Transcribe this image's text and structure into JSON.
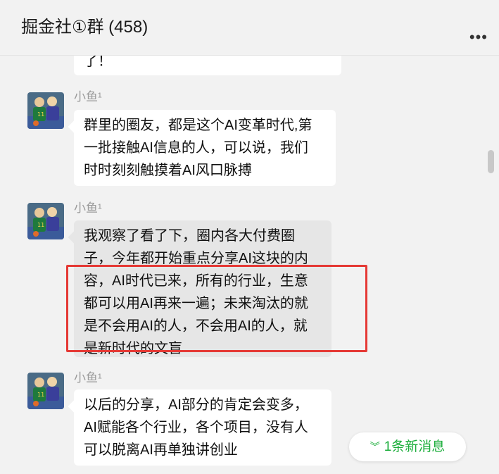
{
  "header": {
    "title": "掘金社①群 (458)",
    "more_icon": "more-dots-icon"
  },
  "messages": [
    {
      "sender": "",
      "text": "了！",
      "partial": true
    },
    {
      "sender": "小鱼¹",
      "lines": [
        "群里的圈友，都是这个AI变革时代,第",
        "一批接触AI信息的人，可以说，我们",
        "时时刻刻触摸着AI风口脉搏"
      ]
    },
    {
      "sender": "小鱼¹",
      "selected": true,
      "lines": [
        "我观察了看了下，圈内各大付费圈",
        "子，今年都开始重点分享AI这块的内",
        "容，AI时代已来，所有的行业，生意",
        "都可以用AI再来一遍；未来淘汰的就",
        "是不会用AI的人，不会用AI的人，就",
        "是新时代的文盲"
      ]
    },
    {
      "sender": "小鱼¹",
      "lines": [
        "以后的分享，AI部分的肯定会变多，",
        "AI赋能各个行业，各个项目，没有人",
        "可以脱离AI再单独讲创业"
      ]
    }
  ],
  "new_message_button": {
    "icon": "double-chevron-down-icon",
    "label": "1条新消息"
  },
  "colors": {
    "highlight_border": "#e53935",
    "new_message_text": "#1aad3a",
    "selected_bubble": "#e6e6e6"
  }
}
